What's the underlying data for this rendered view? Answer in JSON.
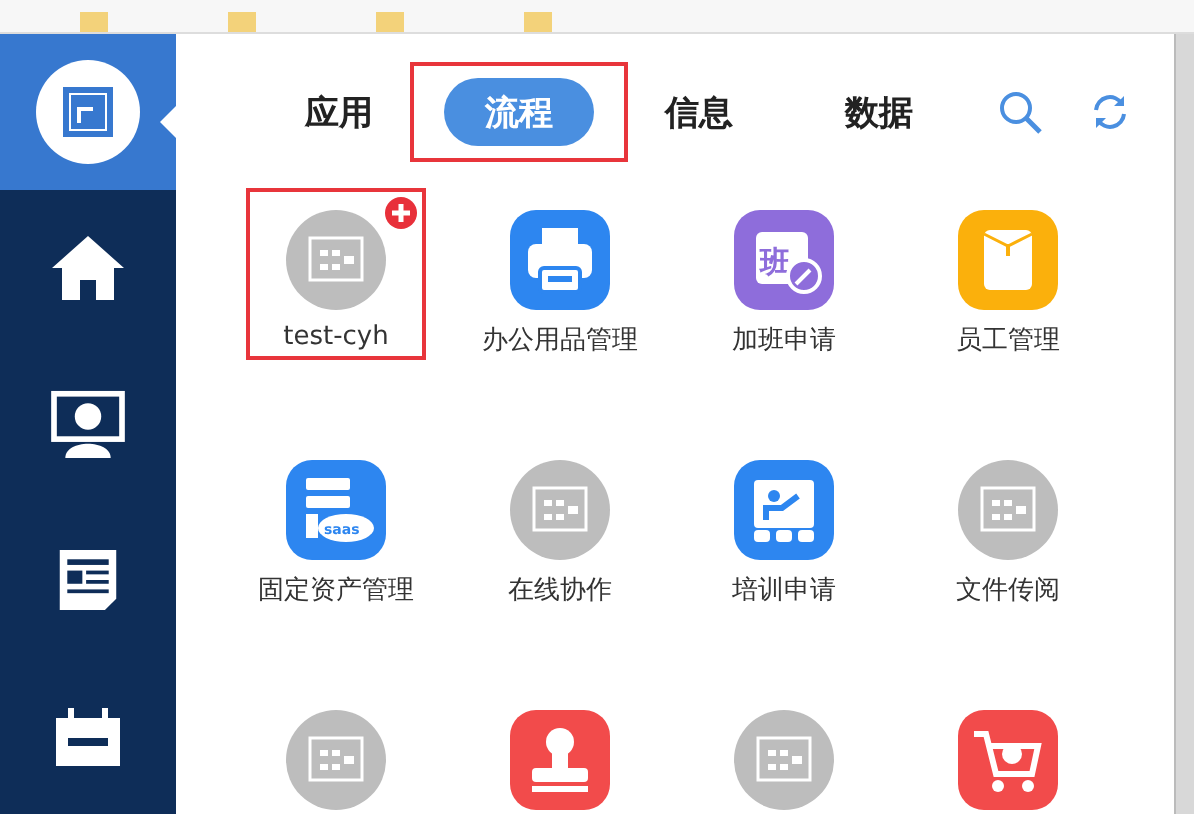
{
  "sidebar": {
    "items": [
      {
        "kind": "logo",
        "selected": true
      },
      {
        "kind": "home",
        "selected": false
      },
      {
        "kind": "monitor",
        "selected": false
      },
      {
        "kind": "news",
        "selected": false
      },
      {
        "kind": "calendar",
        "selected": false
      }
    ]
  },
  "tabs": [
    {
      "label": "应用",
      "selected": false,
      "highlighted": false
    },
    {
      "label": "流程",
      "selected": true,
      "highlighted": true
    },
    {
      "label": "信息",
      "selected": false,
      "highlighted": false
    },
    {
      "label": "数据",
      "selected": false,
      "highlighted": false
    }
  ],
  "items": [
    {
      "kind": "flow",
      "label": "test-cyh",
      "badge": true,
      "highlighted": true
    },
    {
      "kind": "printer",
      "label": "办公用品管理",
      "badge": false,
      "highlighted": false
    },
    {
      "kind": "overtime",
      "label": "加班申请",
      "glyph": "班",
      "badge": false,
      "highlighted": false
    },
    {
      "kind": "envelope",
      "label": "员工管理",
      "badge": false,
      "highlighted": false
    },
    {
      "kind": "server",
      "label": "固定资产管理",
      "glyph": "saas",
      "badge": false,
      "highlighted": false
    },
    {
      "kind": "flow",
      "label": "在线协作",
      "badge": false,
      "highlighted": false
    },
    {
      "kind": "training",
      "label": "培训申请",
      "badge": false,
      "highlighted": false
    },
    {
      "kind": "flow",
      "label": "文件传阅",
      "badge": false,
      "highlighted": false
    },
    {
      "kind": "flow",
      "badge": false,
      "highlighted": false
    },
    {
      "kind": "stamp",
      "badge": false,
      "highlighted": false
    },
    {
      "kind": "flow",
      "badge": false,
      "highlighted": false
    },
    {
      "kind": "cart",
      "badge": false,
      "highlighted": false
    }
  ]
}
